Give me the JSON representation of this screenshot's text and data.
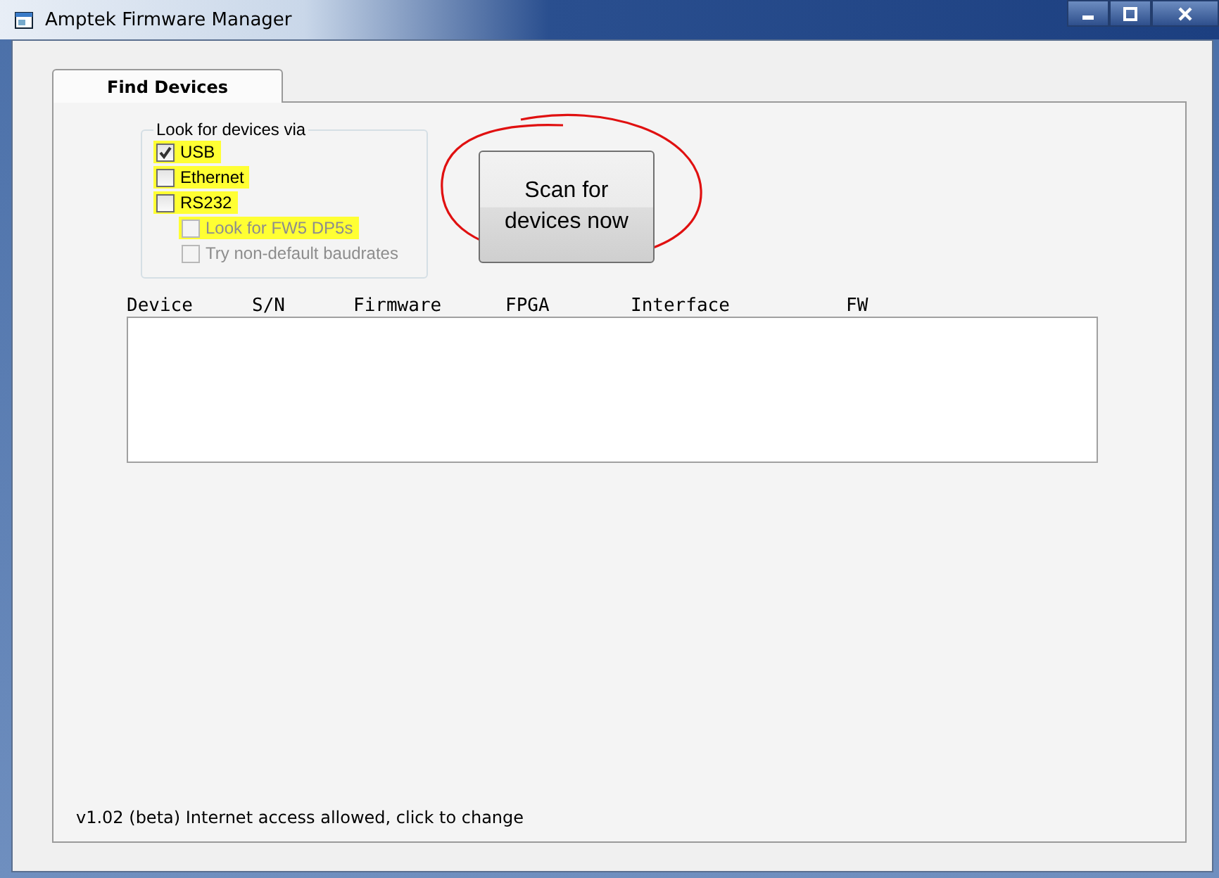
{
  "window": {
    "title": "Amptek Firmware Manager"
  },
  "tabs": [
    {
      "label": "Find Devices",
      "selected": true
    }
  ],
  "look_for": {
    "title": "Look for devices via",
    "options": [
      {
        "label": "USB",
        "checked": true,
        "disabled": false,
        "highlighted": true
      },
      {
        "label": "Ethernet",
        "checked": false,
        "disabled": false,
        "highlighted": true
      },
      {
        "label": "RS232",
        "checked": false,
        "disabled": false,
        "highlighted": true,
        "children": [
          {
            "label": "Look for FW5 DP5s",
            "checked": false,
            "disabled": true,
            "highlighted": true
          },
          {
            "label": "Try non-default baudrates",
            "checked": false,
            "disabled": true,
            "highlighted": false
          }
        ]
      }
    ]
  },
  "scan_button": {
    "label": "Scan for devices now",
    "circled": true
  },
  "device_table": {
    "columns": [
      "Device",
      "S/N",
      "Firmware",
      "FPGA",
      "Interface",
      "FW"
    ]
  },
  "status_bar": "v1.02 (beta) Internet access allowed, click to change"
}
